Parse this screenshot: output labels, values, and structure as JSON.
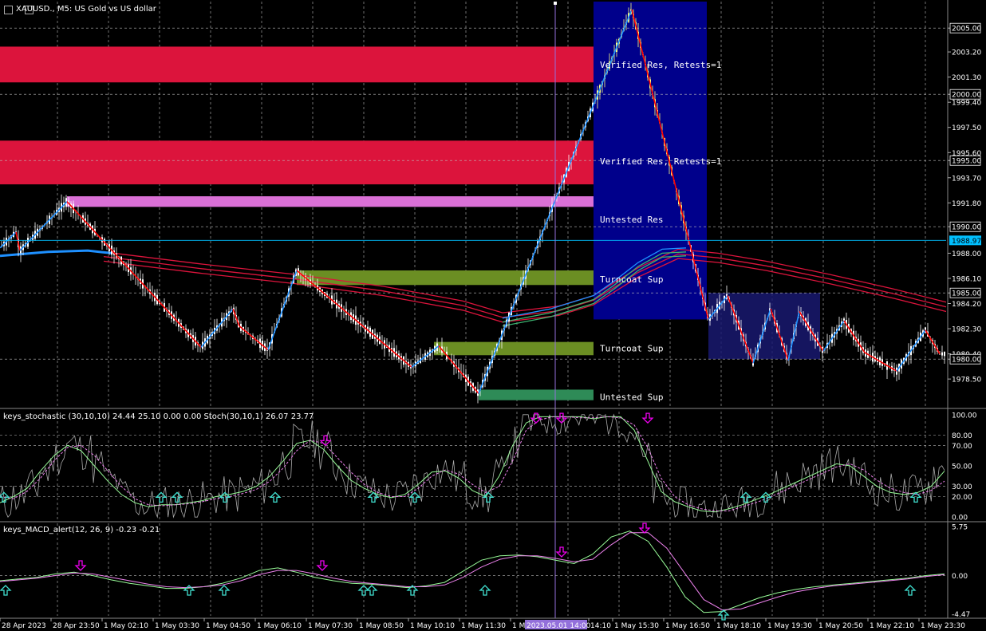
{
  "title": "XAUUSD., M5:  US Gold vs US dollar",
  "stoch_label": "keys_stochastic (30,10,10) 24.44 25.10 0.00 0.00 Stoch(30,10,1) 26.07 23.77",
  "macd_label": "keys_MACD_alert(12, 26, 9) -0.23 -0.21",
  "colors": {
    "background": "#000000",
    "resistance_strong": "#dc143c",
    "resistance_weak": "#da70d6",
    "support": "#6b8e23",
    "support_untested": "#2e8b57",
    "box": "#00008b",
    "box2": "#191970",
    "zigzag_up": "#1e90ff",
    "zigzag_down": "#ff0000",
    "ma_fast": "#1e90ff",
    "ma_slow": "#dc143c",
    "current_price": "#00bfff",
    "vline": "#9370db",
    "candle": "#ffffff",
    "candle_hi": "#ffff80"
  },
  "chart_data": [
    {
      "type": "candlestick",
      "title": "XAUUSD., M5:  US Gold vs US dollar",
      "ylim": [
        1976.4,
        2007.0
      ],
      "yticks": [
        {
          "value": 2005.0,
          "label": "2005.00",
          "boxed": true
        },
        {
          "value": 2003.2,
          "label": "2003.20"
        },
        {
          "value": 2001.3,
          "label": "2001.30"
        },
        {
          "value": 2000.0,
          "label": "2000.00",
          "boxed": true
        },
        {
          "value": 1999.4,
          "label": "1999.40"
        },
        {
          "value": 1997.5,
          "label": "1997.50"
        },
        {
          "value": 1995.6,
          "label": "1995.60"
        },
        {
          "value": 1995.0,
          "label": "1995.00",
          "boxed": true
        },
        {
          "value": 1993.7,
          "label": "1993.70"
        },
        {
          "value": 1991.8,
          "label": "1991.80"
        },
        {
          "value": 1990.0,
          "label": "1990.00",
          "boxed": true
        },
        {
          "value": 1988.0,
          "label": "1988.00"
        },
        {
          "value": 1986.1,
          "label": "1986.10"
        },
        {
          "value": 1985.0,
          "label": "1985.00",
          "boxed": true
        },
        {
          "value": 1984.2,
          "label": "1984.20"
        },
        {
          "value": 1982.3,
          "label": "1982.30"
        },
        {
          "value": 1980.4,
          "label": "1980.40"
        },
        {
          "value": 1980.0,
          "label": "1980.00",
          "boxed": true
        },
        {
          "value": 1978.5,
          "label": "1978.50"
        }
      ],
      "current_price": {
        "value": 1988.97,
        "label": "1988.97"
      },
      "zones": [
        {
          "label": "Verified Res, Retests=1",
          "y_top": 2003.6,
          "y_bottom": 2000.9,
          "x_start": 0,
          "color": "resistance_strong"
        },
        {
          "label": "Verified Res, Retests=1",
          "y_top": 1996.5,
          "y_bottom": 1993.2,
          "x_start": 0,
          "color": "resistance_strong"
        },
        {
          "label": "Untested Res",
          "y_top": 1992.3,
          "y_bottom": 1991.5,
          "x_start": 84,
          "color": "resistance_weak"
        },
        {
          "label": "Turncoat Sup",
          "y_top": 1986.7,
          "y_bottom": 1985.6,
          "x_start": 372,
          "color": "support"
        },
        {
          "label": "Turncoat Sup",
          "y_top": 1981.3,
          "y_bottom": 1980.3,
          "x_start": 544,
          "color": "support"
        },
        {
          "label": "Untested Sup",
          "y_top": 1977.7,
          "y_bottom": 1976.9,
          "x_start": 600,
          "color": "support_untested"
        }
      ],
      "boxes": [
        {
          "y_top": 2007.0,
          "y_bottom": 1983.0,
          "x_start": 744,
          "x_end": 886,
          "color": "box"
        },
        {
          "y_top": 1985.0,
          "y_bottom": 1980.0,
          "x_start": 888,
          "x_end": 1028,
          "color": "box2"
        }
      ],
      "zigzag": [
        [
          0,
          1988.4
        ],
        [
          20,
          1989.6
        ],
        [
          25,
          1988.2
        ],
        [
          84,
          1991.9
        ],
        [
          252,
          1980.9
        ],
        [
          292,
          1983.8
        ],
        [
          300,
          1982.5
        ],
        [
          336,
          1980.7
        ],
        [
          372,
          1986.7
        ],
        [
          516,
          1979.4
        ],
        [
          550,
          1981.0
        ],
        [
          600,
          1977.4
        ],
        [
          696,
          1992.0
        ],
        [
          792,
          2006.4
        ],
        [
          888,
          1983.0
        ],
        [
          912,
          1984.8
        ],
        [
          944,
          1979.7
        ],
        [
          966,
          1983.8
        ],
        [
          988,
          1979.9
        ],
        [
          1002,
          1983.6
        ],
        [
          1032,
          1980.6
        ],
        [
          1058,
          1982.9
        ],
        [
          1084,
          1980.5
        ],
        [
          1124,
          1979.1
        ],
        [
          1160,
          1982.2
        ],
        [
          1178,
          1980.4
        ]
      ],
      "x_labels": [
        "28 Apr 2023",
        "28 Apr 23:50",
        "1 May 02:10",
        "1 May 03:30",
        "1 May 04:50",
        "1 May 06:10",
        "1 May 07:30",
        "1 May 08:50",
        "1 May 10:10",
        "1 May 11:30",
        "1 May 1",
        "2023.05.01 14:00",
        "14:10",
        "1 May 15:30",
        "1 May 16:50",
        "1 May 18:10",
        "1 May 19:30",
        "1 May 20:50",
        "1 May 22:10",
        "1 May 23:30"
      ],
      "zone_labels": [
        "Verified Res, Retests=1",
        "Verified Res, Retests=1",
        "Untested Res",
        "Turncoat Sup",
        "Turncoat Sup",
        "Untested Sup"
      ]
    },
    {
      "type": "line",
      "title": "keys_stochastic (30,10,10) 24.44 25.10 0.00 0.00 Stoch(30,10,1) 26.07 23.77",
      "ylim": [
        -3,
        103
      ],
      "yticks": [
        "100.00",
        "80.00",
        "70.00",
        "50.00",
        "30.00",
        "20.00",
        "0.00"
      ],
      "ytick_values": [
        100,
        80,
        70,
        50,
        30,
        20,
        0
      ],
      "series": [
        {
          "values": [
            14,
            20,
            28,
            45,
            60,
            70,
            65,
            50,
            35,
            22,
            14,
            10,
            12,
            12,
            14,
            16,
            20,
            22,
            25,
            30,
            40,
            55,
            72,
            75,
            66,
            50,
            36,
            28,
            22,
            19,
            22,
            32,
            44,
            45,
            38,
            26,
            20,
            40,
            70,
            92,
            98,
            98,
            98,
            98,
            96,
            98,
            98,
            85,
            55,
            25,
            15,
            10,
            6,
            5,
            8,
            12,
            17,
            22,
            28,
            34,
            40,
            46,
            52,
            50,
            40,
            30,
            24,
            22,
            24,
            30,
            45
          ]
        },
        {
          "values": [
            20,
            18,
            25,
            38,
            55,
            68,
            70,
            60,
            45,
            30,
            18,
            12,
            11,
            12,
            13,
            15,
            18,
            20,
            23,
            27,
            35,
            48,
            65,
            75,
            72,
            58,
            44,
            32,
            24,
            20,
            20,
            28,
            40,
            46,
            42,
            32,
            24,
            30,
            55,
            85,
            95,
            98,
            98,
            97,
            97,
            98,
            97,
            90,
            68,
            38,
            20,
            12,
            8,
            6,
            6,
            10,
            14,
            19,
            25,
            31,
            37,
            43,
            49,
            52,
            46,
            36,
            28,
            24,
            22,
            26,
            35
          ]
        }
      ],
      "arrows_up": [
        5,
        202,
        222,
        282,
        345,
        468,
        520,
        612,
        935,
        960,
        1148
      ],
      "arrows_down": [
        408,
        672,
        704,
        812
      ]
    },
    {
      "type": "line",
      "title": "keys_MACD_alert(12, 26, 9) -0.23 -0.21",
      "ylim": [
        -4.7,
        6.1
      ],
      "yticks": [
        "5.75",
        "0.00",
        "-4.47"
      ],
      "ytick_values": [
        5.75,
        0.0,
        -4.47
      ],
      "series": [
        {
          "values": [
            -0.6,
            -0.4,
            -0.2,
            0.2,
            0.4,
            0.0,
            -0.5,
            -0.9,
            -1.2,
            -1.5,
            -1.5,
            -1.3,
            -0.9,
            -0.3,
            0.6,
            0.9,
            0.4,
            -0.2,
            -0.6,
            -0.9,
            -1.0,
            -1.2,
            -1.4,
            -1.2,
            -0.8,
            0.5,
            1.8,
            2.3,
            2.4,
            2.2,
            1.8,
            1.4,
            2.5,
            4.5,
            5.2,
            4.0,
            1.0,
            -2.5,
            -4.3,
            -4.2,
            -3.4,
            -2.6,
            -2.0,
            -1.6,
            -1.3,
            -1.1,
            -0.9,
            -0.7,
            -0.5,
            -0.3,
            0.0,
            0.2
          ]
        },
        {
          "values": [
            -0.7,
            -0.5,
            -0.3,
            0.0,
            0.3,
            0.2,
            -0.2,
            -0.6,
            -1.0,
            -1.3,
            -1.4,
            -1.3,
            -1.1,
            -0.6,
            0.1,
            0.6,
            0.6,
            0.2,
            -0.3,
            -0.7,
            -0.9,
            -1.1,
            -1.3,
            -1.3,
            -1.1,
            -0.2,
            1.0,
            1.9,
            2.3,
            2.3,
            2.0,
            1.6,
            1.9,
            3.6,
            5.0,
            5.0,
            3.2,
            0.2,
            -2.8,
            -4.0,
            -3.9,
            -3.2,
            -2.5,
            -1.9,
            -1.5,
            -1.2,
            -1.0,
            -0.8,
            -0.6,
            -0.4,
            -0.1,
            0.1
          ]
        }
      ],
      "arrows_up": [
        7,
        237,
        281,
        456,
        466,
        517,
        608,
        907,
        1141
      ],
      "arrows_down": [
        101,
        404,
        704,
        808
      ]
    }
  ]
}
